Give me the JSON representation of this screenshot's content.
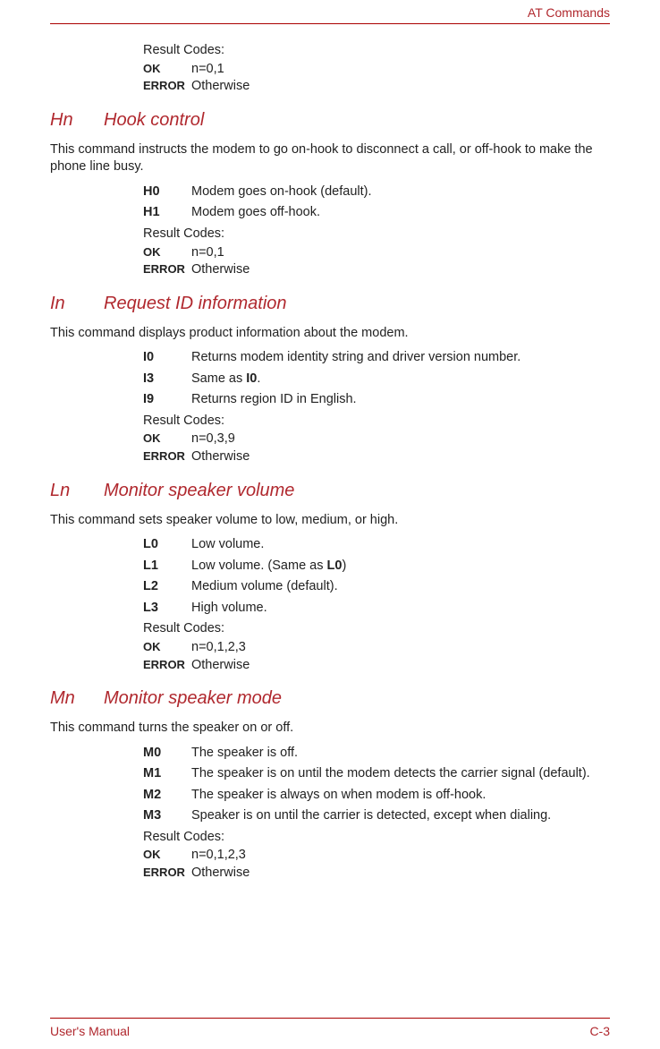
{
  "header": {
    "category": "AT Commands"
  },
  "footer": {
    "manual": "User's Manual",
    "page": "C-3"
  },
  "preResult": {
    "label": "Result Codes:",
    "ok_key": "OK",
    "ok_val": "n=0,1",
    "err_key": "ERROR",
    "err_val": "Otherwise"
  },
  "sections": [
    {
      "cmd": "Hn",
      "title": "Hook control",
      "desc": "This command instructs the modem to go on-hook to disconnect a call, or off-hook to make the phone line busy.",
      "params": [
        {
          "k": "H0",
          "v": "Modem goes on-hook (default)."
        },
        {
          "k": "H1",
          "v": "Modem goes off-hook."
        }
      ],
      "result": {
        "label": "Result Codes:",
        "ok_key": "OK",
        "ok_val": "n=0,1",
        "err_key": "ERROR",
        "err_val": "Otherwise"
      }
    },
    {
      "cmd": "In",
      "title": "Request ID information",
      "desc": "This command displays product information about the modem.",
      "params": [
        {
          "k": "I0",
          "v": "Returns modem identity string and driver version number."
        },
        {
          "k": "I3",
          "v_pre": "Same as ",
          "v_bold": "I0",
          "v_post": "."
        },
        {
          "k": "I9",
          "v": "Returns region ID in English."
        }
      ],
      "result": {
        "label": "Result Codes:",
        "ok_key": "OK",
        "ok_val": "n=0,3,9",
        "err_key": "ERROR",
        "err_val": "Otherwise"
      }
    },
    {
      "cmd": "Ln",
      "title": "Monitor speaker volume",
      "desc": "This command sets speaker volume to low, medium, or high.",
      "params": [
        {
          "k": "L0",
          "v": "Low volume."
        },
        {
          "k": "L1",
          "v_pre": "Low volume. (Same as ",
          "v_bold": "L0",
          "v_post": ")"
        },
        {
          "k": "L2",
          "v": "Medium volume (default)."
        },
        {
          "k": "L3",
          "v": "High volume."
        }
      ],
      "result": {
        "label": "Result Codes:",
        "ok_key": "OK",
        "ok_val": "n=0,1,2,3",
        "err_key": "ERROR",
        "err_val": "Otherwise"
      }
    },
    {
      "cmd": "Mn",
      "title": "Monitor speaker mode",
      "desc": "This command turns the speaker on or off.",
      "params": [
        {
          "k": "M0",
          "v": "The speaker is off."
        },
        {
          "k": "M1",
          "v": "The speaker is on until the modem detects the carrier signal (default)."
        },
        {
          "k": "M2",
          "v": "The speaker is always on when modem is off-hook."
        },
        {
          "k": "M3",
          "v": "Speaker is on until the carrier is detected, except when dialing."
        }
      ],
      "result": {
        "label": "Result Codes:",
        "ok_key": "OK",
        "ok_val": "n=0,1,2,3",
        "err_key": "ERROR",
        "err_val": "Otherwise"
      }
    }
  ]
}
